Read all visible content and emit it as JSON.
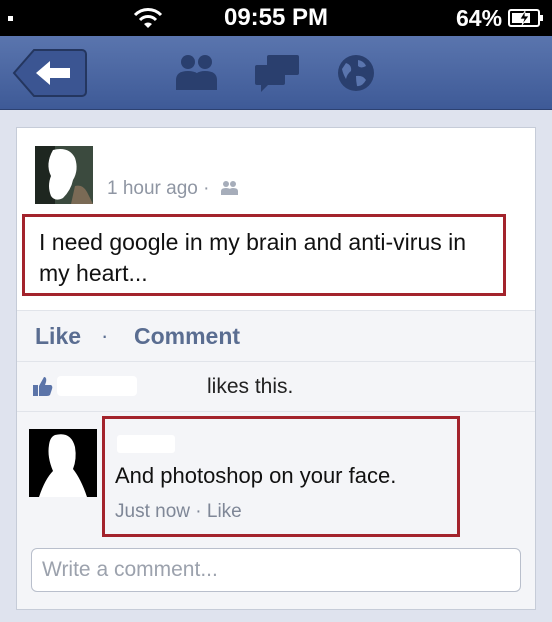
{
  "status_bar": {
    "time": "09:55 PM",
    "battery": "64%"
  },
  "nav": {
    "back_icon": "back-arrow-icon",
    "icons": [
      "friends-icon",
      "messages-icon",
      "globe-icon"
    ],
    "bar_color": "#3e5a97"
  },
  "post": {
    "timestamp": "1 hour ago ·",
    "audience_icon": "friends-icon",
    "text": "I need google in my brain and anti-virus in my heart...",
    "highlight_color": "#a3232c"
  },
  "actions": {
    "like": "Like",
    "separator": "·",
    "comment": "Comment"
  },
  "likes": {
    "text": "likes this."
  },
  "comment": {
    "text": "And photoshop on your face.",
    "time": "Just now",
    "separator": "·",
    "like": "Like"
  },
  "composer": {
    "placeholder": "Write a comment..."
  }
}
